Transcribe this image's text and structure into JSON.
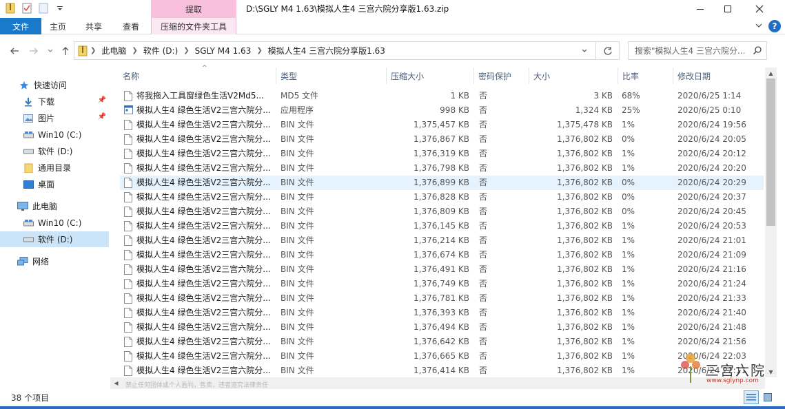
{
  "titlebar": {
    "tool_tab_label": "提取",
    "title": "D:\\SGLY M4 1.63\\模拟人生4 三宫六院分享版1.63.zip",
    "window_controls": [
      "minimize-icon",
      "maximize-icon",
      "close-icon"
    ]
  },
  "ribbon": {
    "file_tab": "文件",
    "tabs": [
      "主页",
      "共享",
      "查看"
    ],
    "manage_tab": "压缩的文件夹工具",
    "accent_color": "#1979ca",
    "tool_color": "#f8c0dc"
  },
  "address": {
    "crumbs": [
      "此电脑",
      "软件 (D:)",
      "SGLY M4 1.63",
      "模拟人生4 三宫六院分享版1.63"
    ]
  },
  "search": {
    "placeholder": "搜索\"模拟人生4 三宫六院分..."
  },
  "navpane": {
    "items": [
      {
        "label": "快速访问",
        "icon": "star-icon"
      },
      {
        "label": "下载",
        "icon": "download-icon"
      },
      {
        "label": "图片",
        "icon": "pictures-icon"
      },
      {
        "label": "Win10 (C:)",
        "icon": "drive-icon"
      },
      {
        "label": "软件 (D:)",
        "icon": "drive-icon"
      },
      {
        "label": "通用目录",
        "icon": "folder-icon"
      },
      {
        "label": "桌面",
        "icon": "desktop-icon"
      },
      {
        "label": "此电脑",
        "icon": "computer-icon"
      },
      {
        "label": "Win10 (C:)",
        "icon": "drive-icon"
      },
      {
        "label": "软件 (D:)",
        "icon": "drive-icon"
      },
      {
        "label": "网络",
        "icon": "network-icon"
      }
    ]
  },
  "columns": [
    "名称",
    "类型",
    "压缩大小",
    "密码保护",
    "大小",
    "比率",
    "修改日期"
  ],
  "files": [
    {
      "name": "将我拖入工具窗绿色生活V2Md5...",
      "type": "MD5 文件",
      "comp": "1 KB",
      "pwd": "否",
      "size": "3 KB",
      "ratio": "68%",
      "date": "2020/6/25 1:14"
    },
    {
      "name": "模拟人生4 绿色生活V2三宫六院分...",
      "type": "应用程序",
      "comp": "998 KB",
      "pwd": "否",
      "size": "1,324 KB",
      "ratio": "25%",
      "date": "2020/6/25 0:10"
    },
    {
      "name": "模拟人生4 绿色生活V2三宫六院分...",
      "type": "BIN 文件",
      "comp": "1,375,457 KB",
      "pwd": "否",
      "size": "1,375,478 KB",
      "ratio": "1%",
      "date": "2020/6/24 19:56"
    },
    {
      "name": "模拟人生4 绿色生活V2三宫六院分...",
      "type": "BIN 文件",
      "comp": "1,376,867 KB",
      "pwd": "否",
      "size": "1,376,802 KB",
      "ratio": "0%",
      "date": "2020/6/24 20:05"
    },
    {
      "name": "模拟人生4 绿色生活V2三宫六院分...",
      "type": "BIN 文件",
      "comp": "1,376,319 KB",
      "pwd": "否",
      "size": "1,376,802 KB",
      "ratio": "1%",
      "date": "2020/6/24 20:12"
    },
    {
      "name": "模拟人生4 绿色生活V2三宫六院分...",
      "type": "BIN 文件",
      "comp": "1,376,798 KB",
      "pwd": "否",
      "size": "1,376,802 KB",
      "ratio": "1%",
      "date": "2020/6/24 20:20"
    },
    {
      "name": "模拟人生4 绿色生活V2三宫六院分...",
      "type": "BIN 文件",
      "comp": "1,376,899 KB",
      "pwd": "否",
      "size": "1,376,802 KB",
      "ratio": "0%",
      "date": "2020/6/24 20:29"
    },
    {
      "name": "模拟人生4 绿色生活V2三宫六院分...",
      "type": "BIN 文件",
      "comp": "1,376,828 KB",
      "pwd": "否",
      "size": "1,376,802 KB",
      "ratio": "0%",
      "date": "2020/6/24 20:37"
    },
    {
      "name": "模拟人生4 绿色生活V2三宫六院分...",
      "type": "BIN 文件",
      "comp": "1,376,809 KB",
      "pwd": "否",
      "size": "1,376,802 KB",
      "ratio": "0%",
      "date": "2020/6/24 20:45"
    },
    {
      "name": "模拟人生4 绿色生活V2三宫六院分...",
      "type": "BIN 文件",
      "comp": "1,376,145 KB",
      "pwd": "否",
      "size": "1,376,802 KB",
      "ratio": "1%",
      "date": "2020/6/24 20:53"
    },
    {
      "name": "模拟人生4 绿色生活V2三宫六院分...",
      "type": "BIN 文件",
      "comp": "1,376,214 KB",
      "pwd": "否",
      "size": "1,376,802 KB",
      "ratio": "1%",
      "date": "2020/6/24 21:01"
    },
    {
      "name": "模拟人生4 绿色生活V2三宫六院分...",
      "type": "BIN 文件",
      "comp": "1,376,674 KB",
      "pwd": "否",
      "size": "1,376,802 KB",
      "ratio": "1%",
      "date": "2020/6/24 21:09"
    },
    {
      "name": "模拟人生4 绿色生活V2三宫六院分...",
      "type": "BIN 文件",
      "comp": "1,376,491 KB",
      "pwd": "否",
      "size": "1,376,802 KB",
      "ratio": "1%",
      "date": "2020/6/24 21:16"
    },
    {
      "name": "模拟人生4 绿色生活V2三宫六院分...",
      "type": "BIN 文件",
      "comp": "1,376,749 KB",
      "pwd": "否",
      "size": "1,376,802 KB",
      "ratio": "1%",
      "date": "2020/6/24 21:24"
    },
    {
      "name": "模拟人生4 绿色生活V2三宫六院分...",
      "type": "BIN 文件",
      "comp": "1,376,781 KB",
      "pwd": "否",
      "size": "1,376,802 KB",
      "ratio": "1%",
      "date": "2020/6/24 21:33"
    },
    {
      "name": "模拟人生4 绿色生活V2三宫六院分...",
      "type": "BIN 文件",
      "comp": "1,376,393 KB",
      "pwd": "否",
      "size": "1,376,802 KB",
      "ratio": "1%",
      "date": "2020/6/24 21:40"
    },
    {
      "name": "模拟人生4 绿色生活V2三宫六院分...",
      "type": "BIN 文件",
      "comp": "1,376,494 KB",
      "pwd": "否",
      "size": "1,376,802 KB",
      "ratio": "1%",
      "date": "2020/6/24 21:48"
    },
    {
      "name": "模拟人生4 绿色生活V2三宫六院分...",
      "type": "BIN 文件",
      "comp": "1,376,642 KB",
      "pwd": "否",
      "size": "1,376,802 KB",
      "ratio": "1%",
      "date": "2020/6/24 21:56"
    },
    {
      "name": "模拟人生4 绿色生活V2三宫六院分...",
      "type": "BIN 文件",
      "comp": "1,376,665 KB",
      "pwd": "否",
      "size": "1,376,802 KB",
      "ratio": "1%",
      "date": "2020/6/24 22:03"
    },
    {
      "name": "模拟人生4 绿色生活V2三宫六院分...",
      "type": "BIN 文件",
      "comp": "1,376,414 KB",
      "pwd": "否",
      "size": "1,376,802 KB",
      "ratio": "1%",
      "date": "2020/6/24 22:11"
    }
  ],
  "hover_row_index": 6,
  "hscroll_faint_text": "禁止任何团体或个人盈利，售卖，违者追究法律责任",
  "status": {
    "count": "38 个项目"
  },
  "watermark": {
    "text": "三宫六院",
    "url": "www.sglynp.com"
  }
}
